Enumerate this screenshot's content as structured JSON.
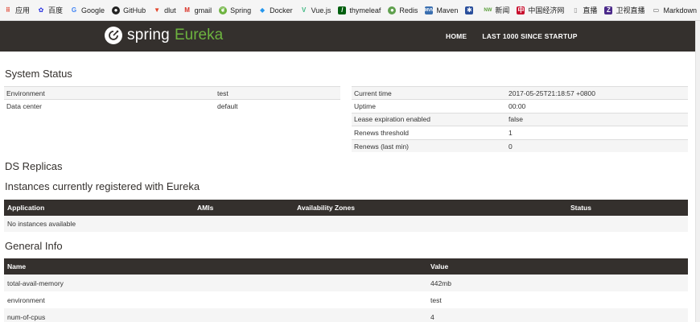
{
  "bookmarks": [
    {
      "label": "应用",
      "icon": "apps-grid-icon",
      "color": "#e15241"
    },
    {
      "label": "百度",
      "icon": "baidu-icon",
      "color": "#2932e1"
    },
    {
      "label": "Google",
      "icon": "google-icon",
      "color": "#4285f4"
    },
    {
      "label": "GitHub",
      "icon": "github-icon",
      "color": "#222222"
    },
    {
      "label": "dlut",
      "icon": "gitlab-icon",
      "color": "#e24329"
    },
    {
      "label": "gmail",
      "icon": "gmail-icon",
      "color": "#d93025"
    },
    {
      "label": "Spring",
      "icon": "spring-icon",
      "color": "#6db33f"
    },
    {
      "label": "Docker",
      "icon": "docker-icon",
      "color": "#2496ed"
    },
    {
      "label": "Vue.js",
      "icon": "vue-icon",
      "color": "#41b883"
    },
    {
      "label": "thymeleaf",
      "icon": "thymeleaf-icon",
      "color": "#005f0f"
    },
    {
      "label": "Redis",
      "icon": "redis-icon",
      "color": "#5fa04e"
    },
    {
      "label": "Maven",
      "icon": "maven-icon",
      "color": "#3a6fb0"
    },
    {
      "label": "",
      "icon": "globe-icon",
      "color": "#2a4f9c"
    },
    {
      "label": "新闻",
      "icon": "news-icon",
      "color": "#5a9e3a"
    },
    {
      "label": "中国经济网",
      "icon": "ce-icon",
      "color": "#c8102e"
    },
    {
      "label": "直播",
      "icon": "document-icon",
      "color": "#888888"
    },
    {
      "label": "卫视直播",
      "icon": "tv-icon",
      "color": "#4b2a8a"
    },
    {
      "label": "Markdown",
      "icon": "book-icon",
      "color": "#555555"
    }
  ],
  "bookmarks_more": "»",
  "brand": {
    "spring": "spring",
    "eureka": "Eureka"
  },
  "nav": [
    "HOME",
    "LAST 1000 SINCE STARTUP"
  ],
  "system_status": {
    "title": "System Status",
    "left": [
      [
        "Environment",
        "test"
      ],
      [
        "Data center",
        "default"
      ]
    ],
    "right": [
      [
        "Current time",
        "2017-05-25T21:18:57 +0800"
      ],
      [
        "Uptime",
        "00:00"
      ],
      [
        "Lease expiration enabled",
        "false"
      ],
      [
        "Renews threshold",
        "1"
      ],
      [
        "Renews (last min)",
        "0"
      ]
    ]
  },
  "ds_replicas": {
    "title": "DS Replicas"
  },
  "instances": {
    "title": "Instances currently registered with Eureka",
    "headers": [
      "Application",
      "AMIs",
      "Availability Zones",
      "Status"
    ],
    "empty": "No instances available"
  },
  "general_info": {
    "title": "General Info",
    "headers": [
      "Name",
      "Value"
    ],
    "rows": [
      [
        "total-avail-memory",
        "442mb"
      ],
      [
        "environment",
        "test"
      ],
      [
        "num-of-cpus",
        "4"
      ]
    ]
  },
  "colors": {
    "nav_bg": "#34302d",
    "brand_green": "#6db33f"
  }
}
